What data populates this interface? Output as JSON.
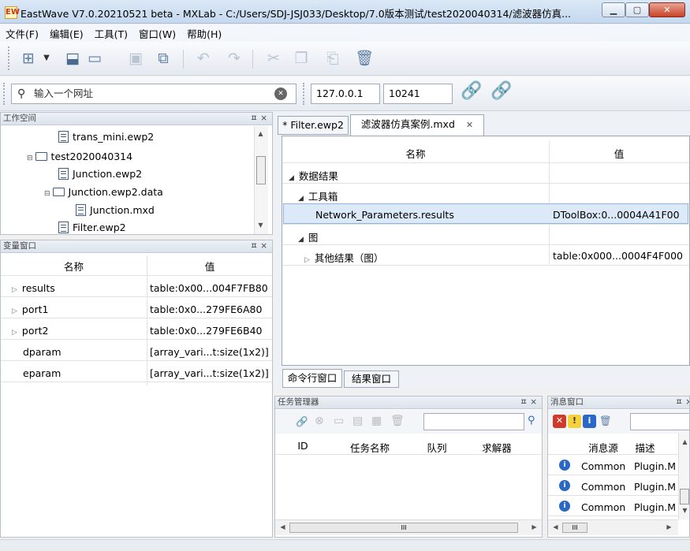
{
  "window": {
    "app_icon": "EW",
    "title": "EastWave V7.0.20210521 beta - MXLab - C:/Users/SDJ-JSJ033/Desktop/7.0版本测试/test2020040314/滤波器仿真...",
    "minimize": "▁",
    "maximize": "▢",
    "close": "✕"
  },
  "menu": [
    "文件(F)",
    "编辑(E)",
    "工具(T)",
    "窗口(W)",
    "帮助(H)"
  ],
  "toolbar_icons": [
    "new-icon",
    "dropdown-icon",
    "import-icon",
    "open-folder-icon",
    "save-icon",
    "copy-project-icon",
    "undo-icon",
    "redo-icon",
    "cut-icon",
    "copy-icon",
    "paste-icon",
    "delete-icon"
  ],
  "address": {
    "url_placeholder": "输入一个网址",
    "ip": "127.0.0.1",
    "port": "10241",
    "clear_glyph": "✕"
  },
  "workspace": {
    "title": "工作空间",
    "pin": "ㅍ ×",
    "items": [
      "trans_mini.ewp2",
      "test2020040314",
      "Junction.ewp2",
      "Junction.ewp2.data",
      "Junction.mxd",
      "Filter.ewp2"
    ]
  },
  "variables": {
    "title": "变量窗口",
    "pin": "ㅍ ×",
    "col_name": "名称",
    "col_value": "值",
    "rows": [
      {
        "name": "results",
        "value": "table:0x00...004F7FB80"
      },
      {
        "name": "port1",
        "value": "table:0x0...279FE6A80"
      },
      {
        "name": "port2",
        "value": "table:0x0...279FE6B40"
      },
      {
        "name": "dparam",
        "value": "[array_vari...t:size(1x2)]"
      },
      {
        "name": "eparam",
        "value": "[array_vari...t:size(1x2)]"
      }
    ]
  },
  "editor": {
    "tabs": [
      "* Filter.ewp2",
      "滤波器仿真案例.mxd"
    ],
    "tab_close": "✕",
    "col_name": "名称",
    "col_value": "值",
    "rows": [
      {
        "name": "数据结果",
        "value": ""
      },
      {
        "name": "工具箱",
        "value": ""
      },
      {
        "name": "Network_Parameters.results",
        "value": "DToolBox:0...0004A41F00"
      },
      {
        "name": "图",
        "value": ""
      },
      {
        "name": "其他结果（图）",
        "value": "table:0x000...0004F4F000"
      }
    ],
    "bottom_tabs": [
      "命令行窗口",
      "结果窗口"
    ]
  },
  "tasks": {
    "title": "任务管理器",
    "pin": "ㅍ ×",
    "columns": [
      "ID",
      "任务名称",
      "队列",
      "求解器"
    ]
  },
  "messages": {
    "title": "消息窗口",
    "pin": "ㅍ ×",
    "col_source": "消息源",
    "col_desc": "描述",
    "rows": [
      {
        "source": "Common",
        "desc": "Plugin.M"
      },
      {
        "source": "Common",
        "desc": "Plugin.M"
      },
      {
        "source": "Common",
        "desc": "Plugin.M"
      }
    ]
  }
}
